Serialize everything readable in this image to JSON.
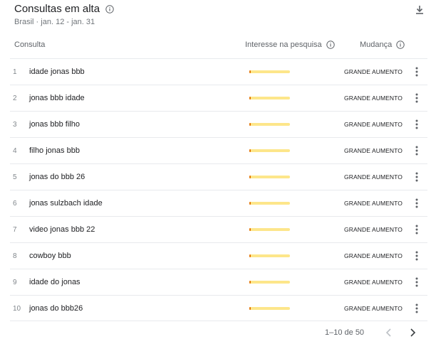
{
  "header": {
    "title": "Consultas em alta",
    "subtitle": "Brasil · jan. 12 - jan. 31"
  },
  "columns": {
    "query": "Consulta",
    "interest": "Interesse na pesquisa",
    "change": "Mudança"
  },
  "colors": {
    "bar_track": "#fde68a",
    "bar_fill": "#e37400"
  },
  "rows": [
    {
      "rank": "1",
      "query": "idade jonas bbb",
      "interest": 0.03,
      "change": "GRANDE AUMENTO"
    },
    {
      "rank": "2",
      "query": "jonas bbb idade",
      "interest": 0.03,
      "change": "GRANDE AUMENTO"
    },
    {
      "rank": "3",
      "query": "jonas bbb filho",
      "interest": 0.03,
      "change": "GRANDE AUMENTO"
    },
    {
      "rank": "4",
      "query": "filho jonas bbb",
      "interest": 0.03,
      "change": "GRANDE AUMENTO"
    },
    {
      "rank": "5",
      "query": "jonas do bbb 26",
      "interest": 0.03,
      "change": "GRANDE AUMENTO"
    },
    {
      "rank": "6",
      "query": "jonas sulzbach idade",
      "interest": 0.03,
      "change": "GRANDE AUMENTO"
    },
    {
      "rank": "7",
      "query": "video jonas bbb 22",
      "interest": 0.02,
      "change": "GRANDE AUMENTO"
    },
    {
      "rank": "8",
      "query": "cowboy bbb",
      "interest": 0.02,
      "change": "GRANDE AUMENTO"
    },
    {
      "rank": "9",
      "query": "idade do jonas",
      "interest": 0.02,
      "change": "GRANDE AUMENTO"
    },
    {
      "rank": "10",
      "query": "jonas do bbb26",
      "interest": 0.02,
      "change": "GRANDE AUMENTO"
    }
  ],
  "pagination": {
    "range": "1–10 de 50"
  }
}
